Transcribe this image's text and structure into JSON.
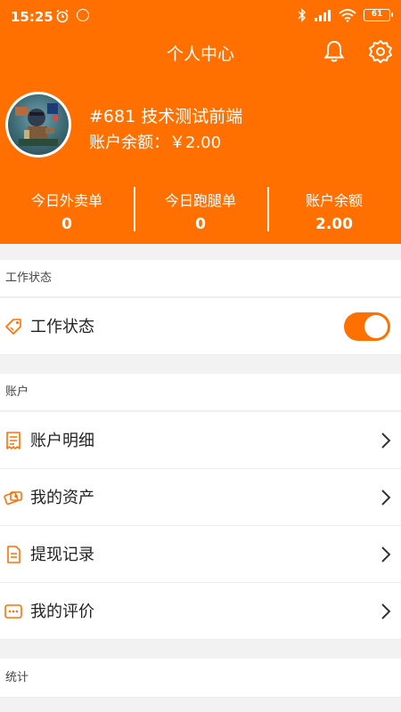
{
  "status_bar": {
    "time": "15:25",
    "battery": "61",
    "icons": [
      "alarm-icon",
      "notification-icon",
      "bluetooth-icon",
      "signal-icon",
      "wifi-icon",
      "battery-icon"
    ]
  },
  "header": {
    "title": "个人中心",
    "icons": [
      "bell-icon",
      "gear-icon"
    ]
  },
  "profile": {
    "store_name": "#681 技术测试前端",
    "balance_line": "账户余额：￥2.00"
  },
  "stats": [
    {
      "label": "今日外卖单",
      "value": "0"
    },
    {
      "label": "今日跑腿单",
      "value": "0"
    },
    {
      "label": "账户余额",
      "value": "2.00"
    }
  ],
  "work_section": {
    "title": "工作状态",
    "row_label": "工作状态",
    "toggle_on": true
  },
  "account_section": {
    "title": "账户",
    "items": [
      {
        "label": "账户明细",
        "icon": "receipt-icon"
      },
      {
        "label": "我的资产",
        "icon": "asset-icon"
      },
      {
        "label": "提现记录",
        "icon": "document-icon"
      },
      {
        "label": "我的评价",
        "icon": "comment-icon"
      }
    ]
  },
  "stats_section": {
    "title": "统计"
  },
  "colors": {
    "brand": "#ff7000",
    "background": "#f2f2f2"
  }
}
